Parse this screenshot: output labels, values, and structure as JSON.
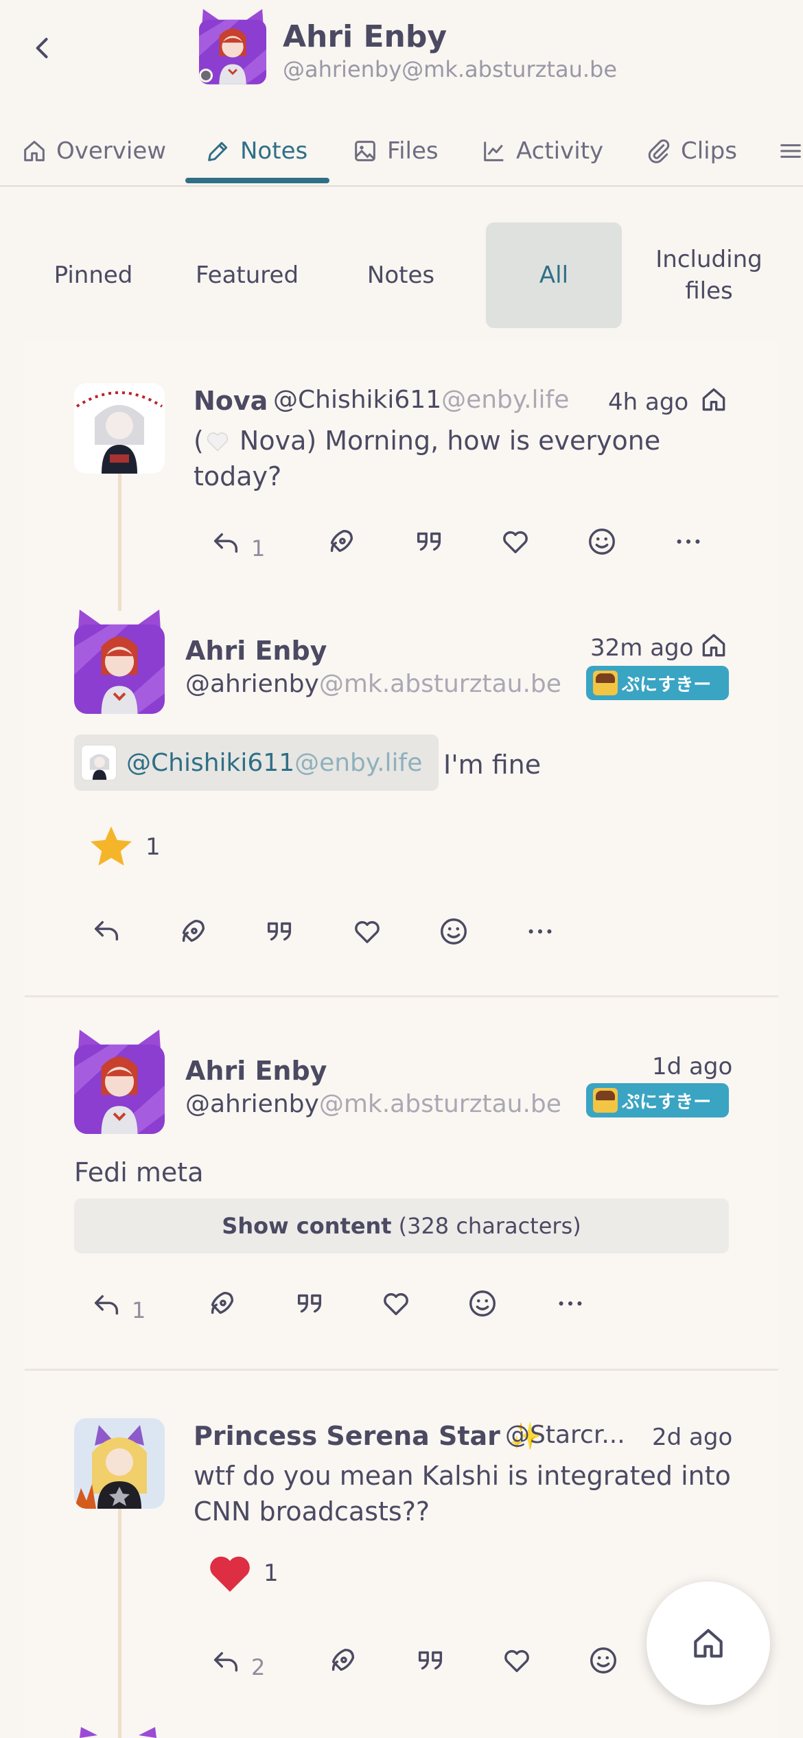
{
  "header": {
    "back_icon": "chevron-left-icon",
    "name": "Ahri Enby",
    "handle": "@ahrienby@mk.absturztau.be"
  },
  "tabs": [
    {
      "label": "Overview",
      "icon": "home-icon"
    },
    {
      "label": "Notes",
      "icon": "pencil-icon",
      "active": true
    },
    {
      "label": "Files",
      "icon": "photo-icon"
    },
    {
      "label": "Activity",
      "icon": "chart-line-icon"
    },
    {
      "label": "Clips",
      "icon": "paperclip-icon"
    },
    {
      "label": "",
      "icon": "menu-icon"
    }
  ],
  "filters": [
    {
      "label": "Pinned"
    },
    {
      "label": "Featured"
    },
    {
      "label": "Notes"
    },
    {
      "label": "All",
      "active": true
    },
    {
      "label": "Including files"
    }
  ],
  "notes": [
    {
      "author": "Nova",
      "user": "@Chishiki611",
      "host": "@enby.life",
      "time": "4h ago",
      "text_prefix": "(",
      "text": " Nova) Morning, how is everyone today?",
      "reply_count": "1"
    },
    {
      "author": "Ahri Enby",
      "user": "@ahrienby",
      "host": "@mk.absturztau.be",
      "time": "32m ago",
      "badge": "ぷにすきー",
      "mention_user": "@Chishiki611",
      "mention_host": "@enby.life",
      "text": "I'm fine",
      "reaction_count": "1"
    },
    {
      "author": "Ahri Enby",
      "user": "@ahrienby",
      "host": "@mk.absturztau.be",
      "time": "1d ago",
      "badge": "ぷにすきー",
      "cw": "Fedi meta",
      "show_content_label": "Show content",
      "show_content_count": "(328 characters)",
      "reply_count": "1"
    },
    {
      "author": "Princess Serena Star",
      "author_emoji": "✨",
      "user_truncated": "@Starcr...",
      "time": "2d ago",
      "text": "wtf do you mean Kalshi is integrated into CNN broadcasts??",
      "reaction_count": "1",
      "reply_count": "2"
    }
  ],
  "colors": {
    "accent": "#2f6f86",
    "background": "#f9f5f1",
    "text": "#4b4a62",
    "muted": "#aaa8b3",
    "badge": "#3aa4c3",
    "star": "#f5b52a",
    "heart": "#dd2e44"
  }
}
